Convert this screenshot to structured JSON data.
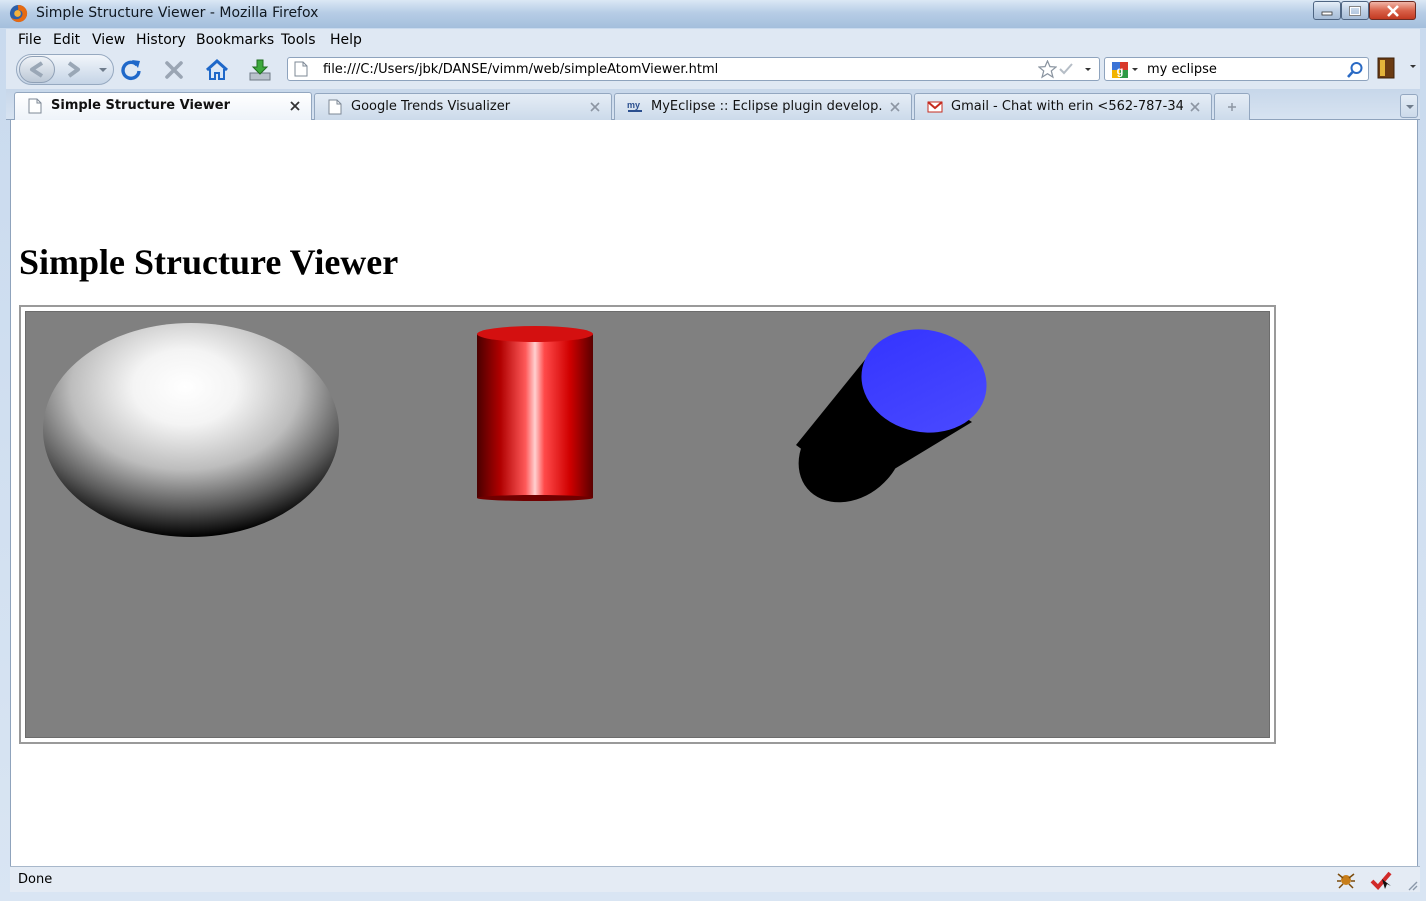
{
  "window": {
    "title": "Simple Structure Viewer - Mozilla Firefox"
  },
  "menu": {
    "items": [
      "File",
      "Edit",
      "View",
      "History",
      "Bookmarks",
      "Tools",
      "Help"
    ]
  },
  "navigation": {
    "url": "file:///C:/Users/jbk/DANSE/vimm/web/simpleAtomViewer.html",
    "search_value": "my eclipse",
    "icons": [
      "back-icon",
      "forward-icon",
      "reload-icon",
      "stop-icon",
      "home-icon",
      "download-icon",
      "bookmark-star-icon",
      "google-icon",
      "search-icon",
      "addon-icon"
    ]
  },
  "tabs": [
    {
      "label": "Simple Structure Viewer",
      "selected": true,
      "icon": "page-icon"
    },
    {
      "label": "Google Trends Visualizer",
      "selected": false,
      "icon": "page-icon"
    },
    {
      "label": "MyEclipse :: Eclipse plugin develop...",
      "selected": false,
      "icon": "myeclipse-icon"
    },
    {
      "label": "Gmail - Chat with erin <562-787-34...",
      "selected": false,
      "icon": "gmail-icon"
    }
  ],
  "page": {
    "heading": "Simple Structure Viewer",
    "viewer": {
      "background_color": "#808080",
      "objects": [
        {
          "shape": "ellipsoid",
          "color": "#ffffff"
        },
        {
          "shape": "cylinder",
          "color": "#ff0000"
        },
        {
          "shape": "tilted-cylinder",
          "color": "#3b3bff",
          "side_color": "#000000"
        }
      ]
    }
  },
  "status": {
    "text": "Done"
  },
  "colors": {
    "window_frame": "#a9c2dc",
    "toolbar": "#dfe8f3",
    "content_background": "#ffffff"
  }
}
